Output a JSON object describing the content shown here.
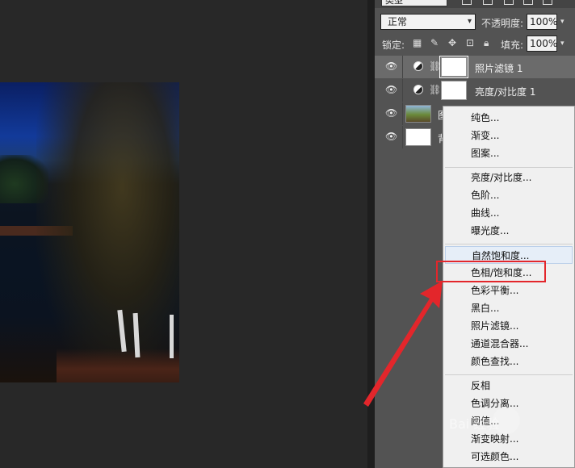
{
  "panel": {
    "kind_label": "类型",
    "blend_mode": "正常",
    "opacity_label": "不透明度:",
    "opacity_value": "100%",
    "lock_label": "锁定:",
    "fill_label": "填充:",
    "fill_value": "100%"
  },
  "layers": [
    {
      "name": "照片滤镜 1",
      "type": "adjustment",
      "selected": true
    },
    {
      "name": "亮度/对比度 1",
      "type": "adjustment",
      "selected": false
    },
    {
      "name": "图",
      "type": "image",
      "selected": false
    },
    {
      "name": "背",
      "type": "background",
      "selected": false
    }
  ],
  "menu": {
    "groups": [
      [
        "纯色...",
        "渐变...",
        "图案..."
      ],
      [
        "亮度/对比度...",
        "色阶...",
        "曲线...",
        "曝光度..."
      ],
      [
        "自然饱和度...",
        "色相/饱和度...",
        "色彩平衡...",
        "黑白...",
        "照片滤镜...",
        "通道混合器...",
        "颜色查找..."
      ],
      [
        "反相",
        "色调分离...",
        "阈值...",
        "渐变映射...",
        "可选颜色..."
      ]
    ],
    "hovered": "自然饱和度...",
    "highlighted": "色相/饱和度..."
  },
  "watermark": {
    "text": "Bai 经验"
  },
  "colors": {
    "annotation_red": "#e3262b",
    "panel_bg": "#535353",
    "workspace_bg": "#282828"
  }
}
